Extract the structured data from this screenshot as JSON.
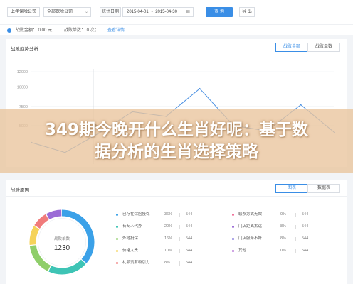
{
  "toolbar": {
    "company_select": "上年保险公司",
    "branch_select": "全部保险公司",
    "date_label": "统计日期",
    "date_start": "2015-04-01",
    "date_sep": "~",
    "date_end": "2015-04-30",
    "query_label": "查 询",
    "export_label": "导 出",
    "chevron": "⌄",
    "calendar": "▦"
  },
  "summary": {
    "amount": "战败金额： 0.00 元；",
    "count": "战败单数： 0 次；",
    "detail_link": "查看详情"
  },
  "trend_card": {
    "title": "战败趋势分析",
    "tabs": [
      "战败金额",
      "战败单数"
    ],
    "active_tab": 0
  },
  "reason_card": {
    "title": "战败原因",
    "tabs": [
      "图表",
      "数据表"
    ],
    "active_tab": 0,
    "donut_label": "战败单数",
    "donut_value": "1230"
  },
  "chart_data": [
    {
      "type": "line",
      "y_ticks": [
        "12000",
        "10000",
        "7500",
        "5000"
      ],
      "ylim": [
        0,
        12000
      ],
      "x": [
        1,
        2,
        3,
        4,
        5,
        6,
        7,
        8,
        9,
        10
      ],
      "series": [
        {
          "values": [
            2800,
            1500,
            4000,
            6800,
            6200,
            9800,
            5000,
            4300,
            7700,
            4100
          ]
        }
      ],
      "grid": true,
      "color": "#4a90e2"
    },
    {
      "type": "pie",
      "slices": [
        {
          "label": "已存在保险投保",
          "percent": "36%",
          "count": "544",
          "value": 36,
          "color": "#3ba1e8"
        },
        {
          "label": "有专人代办",
          "percent": "20%",
          "count": "544",
          "value": 20,
          "color": "#3ec4b5"
        },
        {
          "label": "外地投保",
          "percent": "16%",
          "count": "544",
          "value": 16,
          "color": "#8fce6a"
        },
        {
          "label": "价格太贵",
          "percent": "10%",
          "count": "544",
          "value": 10,
          "color": "#f5d35a"
        },
        {
          "label": "礼品没有吸引力",
          "percent": "8%",
          "count": "544",
          "value": 8,
          "color": "#f07b7b"
        },
        {
          "label": "联系方式无效",
          "percent": "0%",
          "count": "544",
          "value": 0,
          "color": "#f0709a"
        },
        {
          "label": "门店距离太远",
          "percent": "8%",
          "count": "544",
          "value": 8,
          "color": "#9b6bd6"
        },
        {
          "label": "门店服务不好",
          "percent": "8%",
          "count": "544",
          "value": 0,
          "color": "#7a6fd8"
        },
        {
          "label": "其他",
          "percent": "0%",
          "count": "544",
          "value": 0,
          "color": "#b06ad2"
        }
      ]
    }
  ],
  "headline": {
    "line1": "349期今晚开什么生肖好呢：基于数",
    "line2": "据分析的生肖选择策略"
  }
}
